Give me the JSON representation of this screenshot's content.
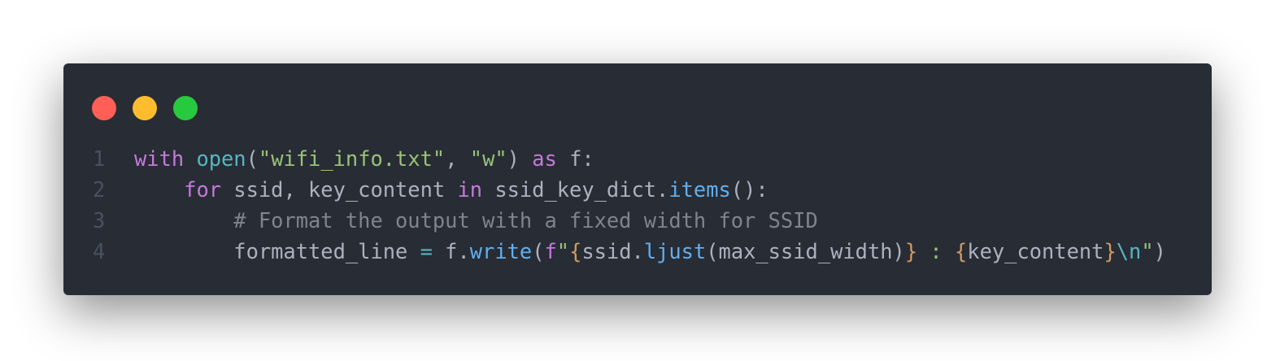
{
  "window_controls": {
    "close_color": "#ff5f56",
    "minimize_color": "#ffbd2e",
    "maximize_color": "#27c93f"
  },
  "colors": {
    "background": "#282c34",
    "keyword": "#c678dd",
    "builtin": "#56b6c2",
    "string": "#98c379",
    "comment": "#7f848e",
    "function": "#61afef",
    "brace": "#d19a66",
    "text": "#abb2bf",
    "line_number": "#495162"
  },
  "code": {
    "language": "python",
    "lines": [
      {
        "number": "1",
        "tokens": [
          {
            "t": "kw",
            "v": "with"
          },
          {
            "t": "plain",
            "v": " "
          },
          {
            "t": "builtin",
            "v": "open"
          },
          {
            "t": "plain",
            "v": "("
          },
          {
            "t": "str",
            "v": "\"wifi_info.txt\""
          },
          {
            "t": "plain",
            "v": ", "
          },
          {
            "t": "str",
            "v": "\"w\""
          },
          {
            "t": "plain",
            "v": ") "
          },
          {
            "t": "kw",
            "v": "as"
          },
          {
            "t": "plain",
            "v": " f:"
          }
        ]
      },
      {
        "number": "2",
        "tokens": [
          {
            "t": "plain",
            "v": "    "
          },
          {
            "t": "kw",
            "v": "for"
          },
          {
            "t": "plain",
            "v": " ssid, key_content "
          },
          {
            "t": "kw",
            "v": "in"
          },
          {
            "t": "plain",
            "v": " ssid_key_dict."
          },
          {
            "t": "func",
            "v": "items"
          },
          {
            "t": "plain",
            "v": "():"
          }
        ]
      },
      {
        "number": "3",
        "tokens": [
          {
            "t": "plain",
            "v": "        "
          },
          {
            "t": "comment",
            "v": "# Format the output with a fixed width for SSID"
          }
        ]
      },
      {
        "number": "4",
        "tokens": [
          {
            "t": "plain",
            "v": "        formatted_line "
          },
          {
            "t": "op",
            "v": "="
          },
          {
            "t": "plain",
            "v": " f."
          },
          {
            "t": "func",
            "v": "write"
          },
          {
            "t": "plain",
            "v": "("
          },
          {
            "t": "kw",
            "v": "f"
          },
          {
            "t": "str",
            "v": "\""
          },
          {
            "t": "brace",
            "v": "{"
          },
          {
            "t": "plain",
            "v": "ssid."
          },
          {
            "t": "func",
            "v": "ljust"
          },
          {
            "t": "plain",
            "v": "(max_ssid_width)"
          },
          {
            "t": "brace",
            "v": "}"
          },
          {
            "t": "str",
            "v": " : "
          },
          {
            "t": "brace",
            "v": "{"
          },
          {
            "t": "plain",
            "v": "key_content"
          },
          {
            "t": "brace",
            "v": "}"
          },
          {
            "t": "esc",
            "v": "\\n"
          },
          {
            "t": "str",
            "v": "\""
          },
          {
            "t": "plain",
            "v": ")"
          }
        ]
      }
    ]
  }
}
